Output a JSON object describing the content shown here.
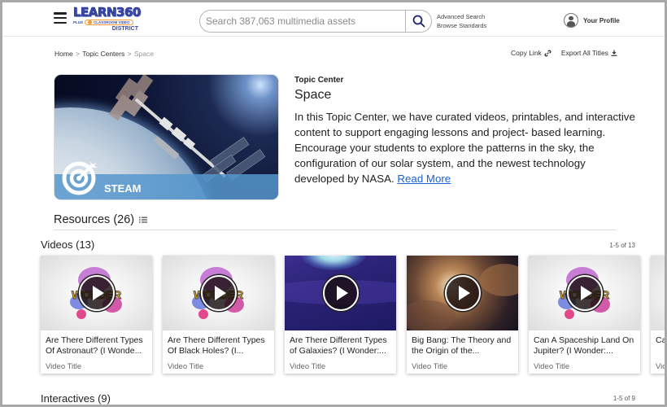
{
  "header": {
    "logo": {
      "line1": "LEARN360",
      "line2_prefix": "PLUS",
      "line2_pill": "CLASSROOM VIDEO",
      "line3": "DISTRICT"
    },
    "menu_icon": "hamburger-icon",
    "search": {
      "placeholder": "Search 387,063 multimedia assets",
      "value": "",
      "icon": "search-icon"
    },
    "links": {
      "advanced_search": "Advanced Search",
      "browse_standards": "Browse Standards"
    },
    "profile_label": "Your Profile",
    "colors": {
      "brand": "#3b4aa8",
      "accent": "#f39c3a"
    }
  },
  "breadcrumb": {
    "items": [
      "Home",
      "Topic Centers",
      "Space"
    ],
    "separator": ">"
  },
  "actions": {
    "copy_link": "Copy Link",
    "export_all": "Export All Titles"
  },
  "topic": {
    "badge": "STEAM",
    "label": "Topic Center",
    "title": "Space",
    "description": "In this Topic Center, we have curated videos, printables, and interactive content to support engaging lessons and project- based learning. Encourage your students to explore the patterns in the sky, the configuration of our solar system, and the newest technology developed by NASA.",
    "read_more": "Read More",
    "link_color": "#1a5fd6"
  },
  "resources": {
    "title": "Resources (26)",
    "list_icon": "list-icon"
  },
  "videos": {
    "title": "Videos (13)",
    "pager": "1-5 of 13",
    "items": [
      {
        "title": "Are There Different Types Of Astronaut? (I Wonde...",
        "subtitle": "Video Title",
        "thumb": "wonder"
      },
      {
        "title": "Are There Different Types Of Black Holes? (I...",
        "subtitle": "Video Title",
        "thumb": "wonder"
      },
      {
        "title": "Are There Different Types of Galaxies? (I Wonder:...",
        "subtitle": "Video Title",
        "thumb": "galaxy"
      },
      {
        "title": "Big Bang: The Theory and the Origin of the...",
        "subtitle": "Video Title",
        "thumb": "bigbang"
      },
      {
        "title": "Can A Spaceship Land On Jupiter? (I Wonder:...",
        "subtitle": "Video Title",
        "thumb": "wonder"
      },
      {
        "title": "Can ... Sur...",
        "subtitle": "Video Title",
        "thumb": "plain"
      }
    ],
    "wonder_text": "WONDER"
  },
  "interactives": {
    "title": "Interactives (9)",
    "pager": "1-5 of 9"
  }
}
